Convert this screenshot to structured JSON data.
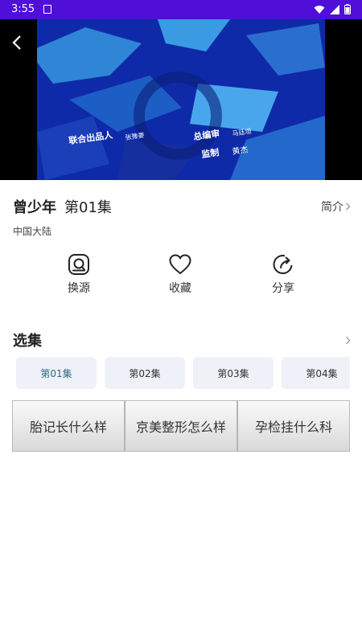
{
  "status": {
    "time": "3:55"
  },
  "video": {
    "credits": [
      "联合出品人",
      "张豫娄",
      "总编审",
      "马廷坦",
      "监制",
      "黄杰"
    ]
  },
  "show": {
    "title": "曾少年",
    "episode": "第01集",
    "intro_label": "简介",
    "region": "中国大陆"
  },
  "actions": [
    {
      "label": "换源",
      "icon": "switch-source-icon"
    },
    {
      "label": "收藏",
      "icon": "heart-icon"
    },
    {
      "label": "分享",
      "icon": "share-icon"
    }
  ],
  "episodes": {
    "title": "选集",
    "items": [
      "第01集",
      "第02集",
      "第03集",
      "第04集"
    ],
    "selected": "第01集"
  },
  "ads": [
    "胎记长什么样",
    "京美整形怎么样",
    "孕检挂什么科"
  ],
  "colors": {
    "status_bar": "#4f0fd8",
    "episode_bg": "#eef1f7",
    "selected_episode_text": "#2f6b86"
  }
}
